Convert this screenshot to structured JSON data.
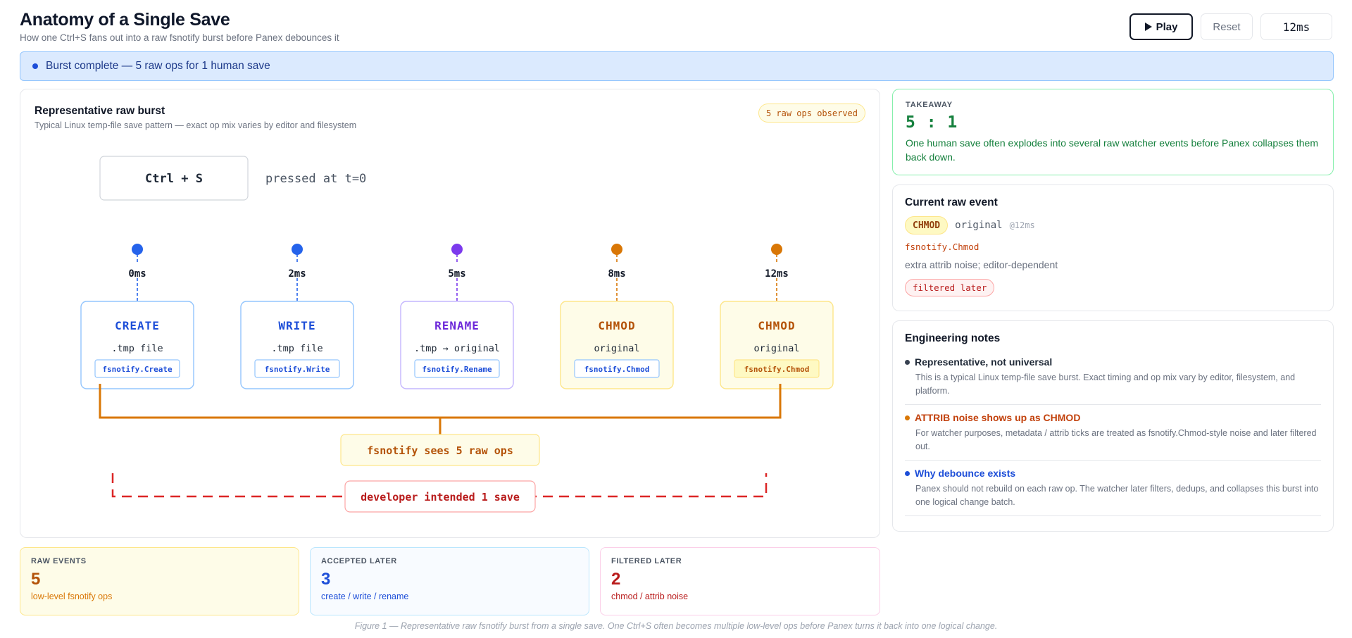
{
  "header": {
    "title": "Anatomy of a Single Save",
    "subtitle": "How one Ctrl+S fans out into a raw fsnotify burst before Panex debounces it",
    "play_label": "Play",
    "reset_label": "Reset",
    "time": "12ms"
  },
  "banner": {
    "text": "Burst complete — 5 raw ops for 1 human save"
  },
  "panel": {
    "title": "Representative raw burst",
    "subtitle": "Typical Linux temp-file save pattern — exact op mix varies by editor and filesystem",
    "ops_pill": "5 raw ops observed",
    "keypress": "Ctrl + S",
    "pressed_text": "pressed at t=0",
    "events": [
      {
        "time": "0ms",
        "op": "CREATE",
        "target": ".tmp file",
        "api": "fsnotify.Create",
        "color": "#1d4ed8",
        "border": "#93c5fd",
        "bg": "#ffffff",
        "api_bg": "#ffffff",
        "active": false
      },
      {
        "time": "2ms",
        "op": "WRITE",
        "target": ".tmp file",
        "api": "fsnotify.Write",
        "color": "#1d4ed8",
        "border": "#93c5fd",
        "bg": "#ffffff",
        "api_bg": "#ffffff",
        "active": false
      },
      {
        "time": "5ms",
        "op": "RENAME",
        "target": ".tmp → original",
        "api": "fsnotify.Rename",
        "color": "#6d28d9",
        "border": "#c4b5fd",
        "bg": "#ffffff",
        "api_bg": "#ffffff",
        "active": false
      },
      {
        "time": "8ms",
        "op": "CHMOD",
        "target": "original",
        "api": "fsnotify.Chmod",
        "color": "#b45309",
        "border": "#fde68a",
        "bg": "#fefce8",
        "api_bg": "#ffffff",
        "active": false
      },
      {
        "time": "12ms",
        "op": "CHMOD",
        "target": "original",
        "api": "fsnotify.Chmod",
        "color": "#b45309",
        "border": "#fde68a",
        "bg": "#fefce8",
        "api_bg": "#fef9c3",
        "active": true
      }
    ],
    "sees_label": "fsnotify sees 5 raw ops",
    "intended_label": "developer intended 1 save",
    "colors": {
      "blue": "#2563eb",
      "purple": "#7c3aed",
      "orange": "#d97706",
      "red": "#dc2626"
    }
  },
  "takeaway": {
    "label": "TAKEAWAY",
    "ratio": "5 : 1",
    "body": "One human save often explodes into several raw watcher events before Panex collapses them back down."
  },
  "current_event": {
    "title": "Current raw event",
    "op": "CHMOD",
    "target": "original",
    "time": "@12ms",
    "api": "fsnotify.Chmod",
    "description": "extra attrib noise; editor-dependent",
    "status": "filtered later"
  },
  "notes": {
    "title": "Engineering notes",
    "items": [
      {
        "heading": "Representative, not universal",
        "body": "This is a typical Linux temp-file save burst. Exact timing and op mix vary by editor, filesystem, and platform.",
        "color": "#374151"
      },
      {
        "heading": "ATTRIB noise shows up as CHMOD",
        "body": "For watcher purposes, metadata / attrib ticks are treated as fsnotify.Chmod-style noise and later filtered out.",
        "color": "#c2410c"
      },
      {
        "heading": "Why debounce exists",
        "body": "Panex should not rebuild on each raw op. The watcher later filters, dedups, and collapses this burst into one logical change batch.",
        "color": "#1d4ed8"
      }
    ]
  },
  "stats": {
    "raw": {
      "label": "RAW EVENTS",
      "value": "5",
      "note": "low-level fsnotify ops",
      "color": "#b45309"
    },
    "accepted": {
      "label": "ACCEPTED LATER",
      "value": "3",
      "note": "create / write / rename",
      "color": "#1d4ed8"
    },
    "filtered": {
      "label": "FILTERED LATER",
      "value": "2",
      "note": "chmod / attrib noise",
      "color": "#b91c1c"
    }
  },
  "caption": "Figure 1 — Representative raw fsnotify burst from a single save. One Ctrl+S often becomes multiple low-level ops before Panex turns it back into one logical change."
}
